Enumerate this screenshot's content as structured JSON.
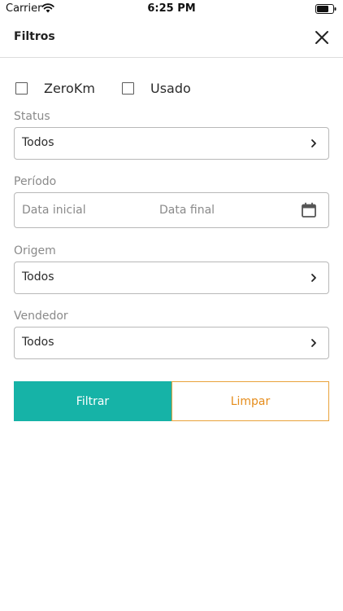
{
  "status_bar": {
    "carrier": "Carrier",
    "time": "6:25 PM"
  },
  "header": {
    "title": "Filtros",
    "close_icon": "close-icon"
  },
  "checkboxes": [
    {
      "label": "ZeroKm",
      "checked": false
    },
    {
      "label": "Usado",
      "checked": false
    }
  ],
  "status": {
    "label": "Status",
    "value": "Todos"
  },
  "periodo": {
    "label": "Período",
    "start_placeholder": "Data inicial",
    "end_placeholder": "Data final"
  },
  "origem": {
    "label": "Origem",
    "value": "Todos"
  },
  "vendedor": {
    "label": "Vendedor",
    "value": "Todos"
  },
  "actions": {
    "filter_label": "Filtrar",
    "clear_label": "Limpar"
  },
  "colors": {
    "primary": "#16b3a7",
    "accent": "#e58c1b",
    "border": "#b8b8b8",
    "muted_text": "#8a8a8a"
  }
}
